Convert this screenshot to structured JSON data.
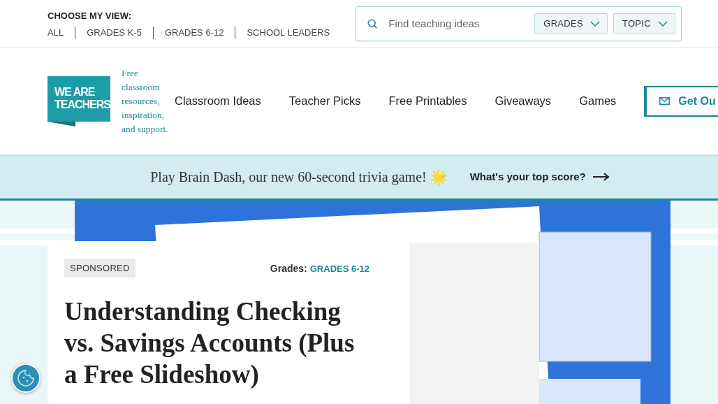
{
  "view_chooser": {
    "title": "CHOOSE MY VIEW:",
    "options": [
      {
        "label": "ALL",
        "selected": false
      },
      {
        "label": "GRADES K-5",
        "selected": false
      },
      {
        "label": "GRADES 6-12",
        "selected": false
      },
      {
        "label": "SCHOOL LEADERS",
        "selected": false
      }
    ]
  },
  "search": {
    "placeholder": "Find teaching ideas",
    "filters": [
      "GRADES",
      "TOPIC"
    ]
  },
  "logo": {
    "lines": [
      "WE ARE",
      "TEACHERS"
    ],
    "tagline": "Free classroom resources, inspiration, and support."
  },
  "nav": [
    "Classroom Ideas",
    "Teacher Picks",
    "Free Printables",
    "Giveaways",
    "Games"
  ],
  "newsletter_button": "Get Ou",
  "banner": {
    "text": "Play Brain Dash, our new 60-second trivia game! 🌟",
    "link": "What's your top score?"
  },
  "article": {
    "badge": "SPONSORED",
    "grades_label": "Grades:",
    "grades_value": "GRADES 6-12",
    "title": "Understanding Checking vs. Savings Accounts (Plus a Free Slideshow)"
  }
}
